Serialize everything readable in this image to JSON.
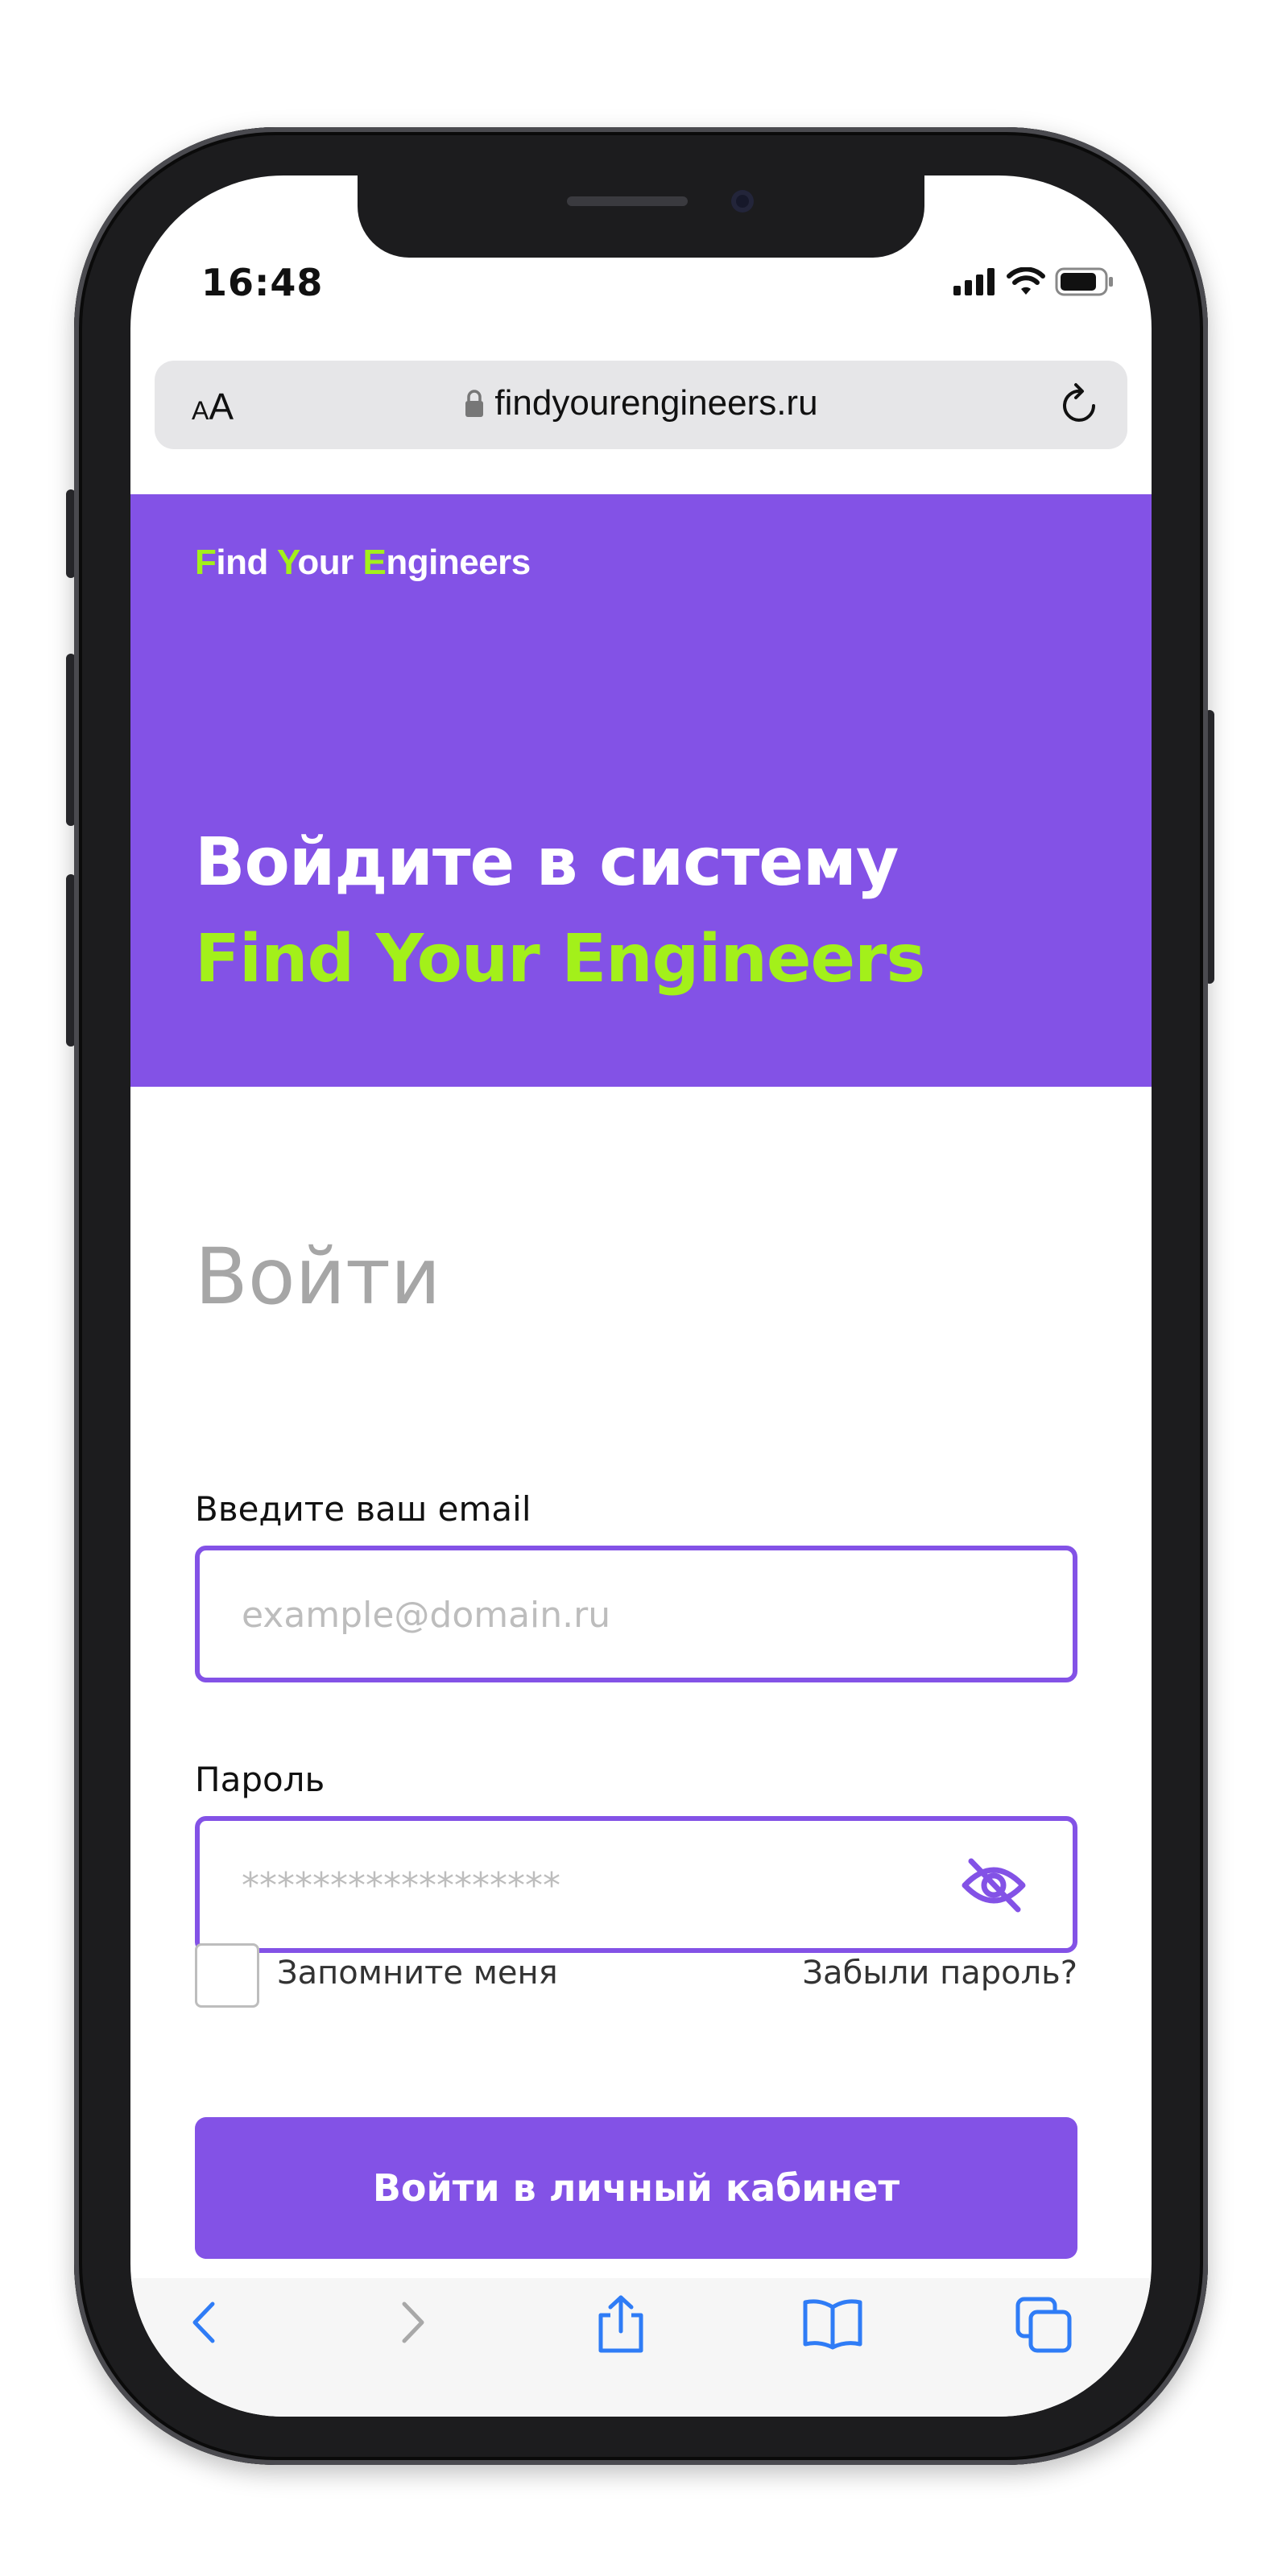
{
  "status_bar": {
    "time": "16:48"
  },
  "browser": {
    "text_size_label_small": "A",
    "text_size_label_large": "A",
    "url": "findyourengineers.ru"
  },
  "hero": {
    "logo": {
      "f": "F",
      "ind": "ind ",
      "y": "Y",
      "our": "our ",
      "e": "E",
      "ngineers": "ngineers"
    },
    "title_line1": "Войдите в систему",
    "title_line2": "Find Your Engineers"
  },
  "form": {
    "title": "Войти",
    "email_label": "Введите ваш email",
    "email_placeholder": "example@domain.ru",
    "password_label": "Пароль",
    "password_placeholder": "******************",
    "remember_label": "Запомните меня",
    "forgot_link": "Забыли пароль?",
    "submit_label": "Войти в личный кабинет"
  },
  "colors": {
    "brand_purple": "#8352e6",
    "brand_green": "#a3f01a",
    "safari_blue": "#2f7cf6"
  },
  "toolbar": {
    "icons": [
      "back-icon",
      "forward-icon",
      "share-icon",
      "bookmarks-icon",
      "tabs-icon"
    ]
  }
}
